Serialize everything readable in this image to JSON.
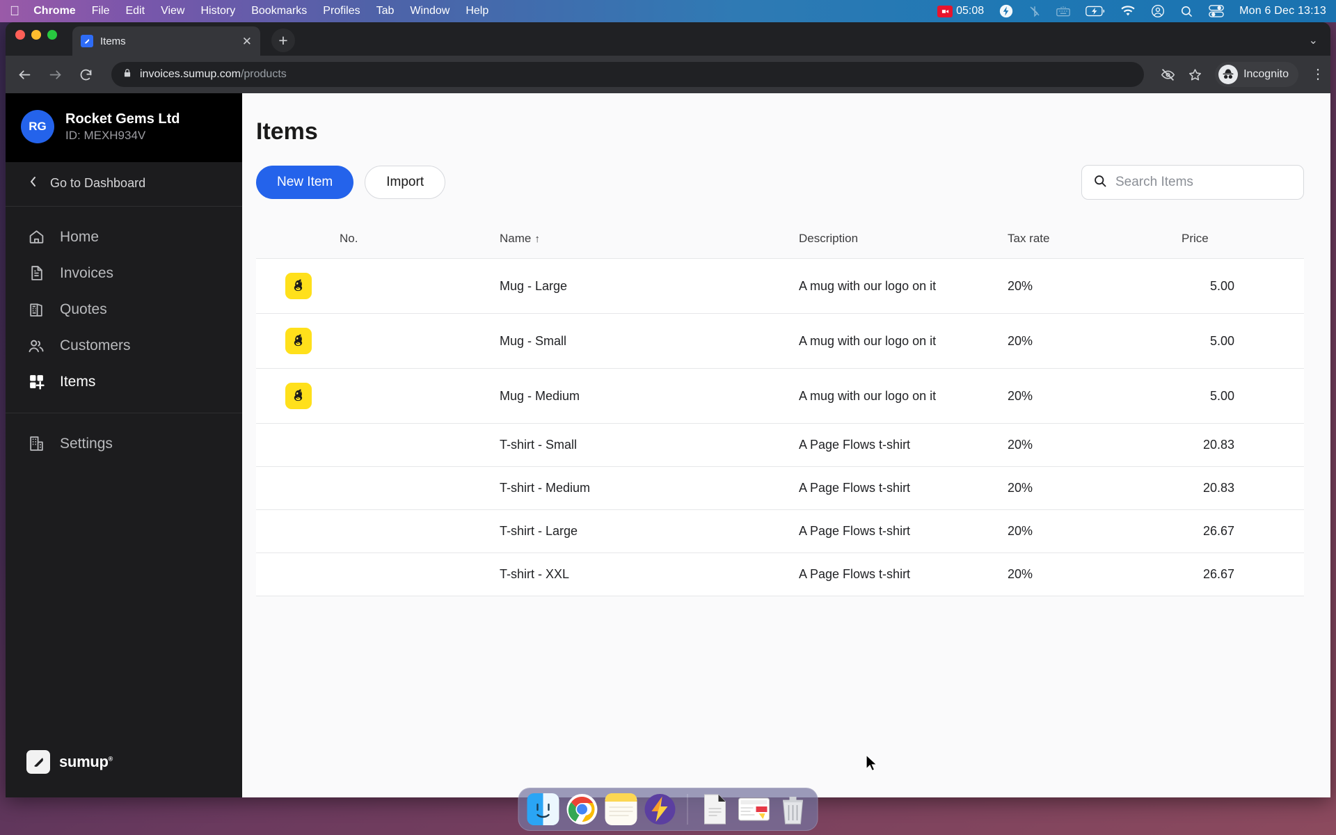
{
  "menubar": {
    "apple_icon": "apple-icon",
    "items": [
      {
        "label": "Chrome",
        "bold": true
      },
      {
        "label": "File",
        "bold": false
      },
      {
        "label": "Edit",
        "bold": false
      },
      {
        "label": "View",
        "bold": false
      },
      {
        "label": "History",
        "bold": false
      },
      {
        "label": "Bookmarks",
        "bold": false
      },
      {
        "label": "Profiles",
        "bold": false
      },
      {
        "label": "Tab",
        "bold": false
      },
      {
        "label": "Window",
        "bold": false
      },
      {
        "label": "Help",
        "bold": false
      }
    ],
    "recording_time": "05:08",
    "status_icons": [
      "screen-record-icon",
      "flash-circle-icon",
      "bluetooth-off-icon",
      "keyboard-brightness-icon",
      "battery-charging-icon",
      "wifi-icon",
      "control-center-user-icon",
      "search-icon",
      "control-center-icon"
    ],
    "datetime": "Mon 6 Dec  13:13"
  },
  "browser": {
    "tab": {
      "title": "Items",
      "favicon": "sumup-favicon",
      "close_icon": "close-icon"
    },
    "new_tab_label": "+",
    "tabstrip_expand_icon": "chevron-down-icon",
    "back_icon": "back-arrow-icon",
    "forward_icon": "forward-arrow-icon",
    "reload_icon": "reload-icon",
    "lock_icon": "lock-icon",
    "url_host": "invoices.sumup.com",
    "url_path": "/products",
    "block_icon": "eye-slash-icon",
    "bookmark_icon": "star-icon",
    "profile_label": "Incognito",
    "profile_icon": "incognito-icon",
    "menu_icon": "kebab-menu-icon"
  },
  "sidebar": {
    "avatar_initials": "RG",
    "business_name": "Rocket Gems Ltd",
    "business_id": "ID: MEXH934V",
    "go_to_dashboard": "Go to Dashboard",
    "back_chevron_icon": "chevron-left-icon",
    "items": [
      {
        "label": "Home",
        "icon": "home-icon",
        "active": false
      },
      {
        "label": "Invoices",
        "icon": "document-icon",
        "active": false
      },
      {
        "label": "Quotes",
        "icon": "quote-document-icon",
        "active": false
      },
      {
        "label": "Customers",
        "icon": "people-icon",
        "active": false
      },
      {
        "label": "Items",
        "icon": "grid-plus-icon",
        "active": true
      }
    ],
    "settings": {
      "label": "Settings",
      "icon": "building-icon"
    },
    "logo_text": "sumup",
    "logo_icon": "sumup-logo-icon"
  },
  "main": {
    "title": "Items",
    "new_item_label": "New Item",
    "import_label": "Import",
    "search": {
      "placeholder": "Search Items",
      "value": "",
      "icon": "search-icon"
    },
    "table": {
      "columns": [
        "",
        "No.",
        "Name",
        "Description",
        "Tax rate",
        "Price"
      ],
      "sort_column": "Name",
      "sort_arrow": "↑",
      "rows": [
        {
          "image": "mailchimp-thumb",
          "no": "",
          "name": "Mug - Large",
          "description": "A mug with our logo on it",
          "tax_rate": "20%",
          "price": "5.00"
        },
        {
          "image": "mailchimp-thumb",
          "no": "",
          "name": "Mug - Small",
          "description": "A mug with our logo on it",
          "tax_rate": "20%",
          "price": "5.00"
        },
        {
          "image": "mailchimp-thumb",
          "no": "",
          "name": "Mug - Medium",
          "description": "A mug with our logo on it",
          "tax_rate": "20%",
          "price": "5.00"
        },
        {
          "image": "",
          "no": "",
          "name": "T-shirt - Small",
          "description": "A Page Flows t-shirt",
          "tax_rate": "20%",
          "price": "20.83"
        },
        {
          "image": "",
          "no": "",
          "name": "T-shirt - Medium",
          "description": "A Page Flows t-shirt",
          "tax_rate": "20%",
          "price": "20.83"
        },
        {
          "image": "",
          "no": "",
          "name": "T-shirt - Large",
          "description": "A Page Flows t-shirt",
          "tax_rate": "20%",
          "price": "26.67"
        },
        {
          "image": "",
          "no": "",
          "name": "T-shirt - XXL",
          "description": "A Page Flows t-shirt",
          "tax_rate": "20%",
          "price": "26.67"
        }
      ]
    }
  },
  "dock": {
    "apps": [
      {
        "name": "finder-icon",
        "running": true
      },
      {
        "name": "chrome-icon",
        "running": true
      },
      {
        "name": "notes-icon",
        "running": true
      },
      {
        "name": "thunder-app-icon",
        "running": true
      },
      {
        "name": "document-file-icon",
        "running": false
      },
      {
        "name": "screenshot-file-icon",
        "running": false
      },
      {
        "name": "trash-icon",
        "running": false
      }
    ]
  },
  "colors": {
    "accent": "#2463eb",
    "sidebar_bg": "#1c1c1e",
    "thumb_yellow": "#ffe01b",
    "page_bg": "#fafafb"
  }
}
